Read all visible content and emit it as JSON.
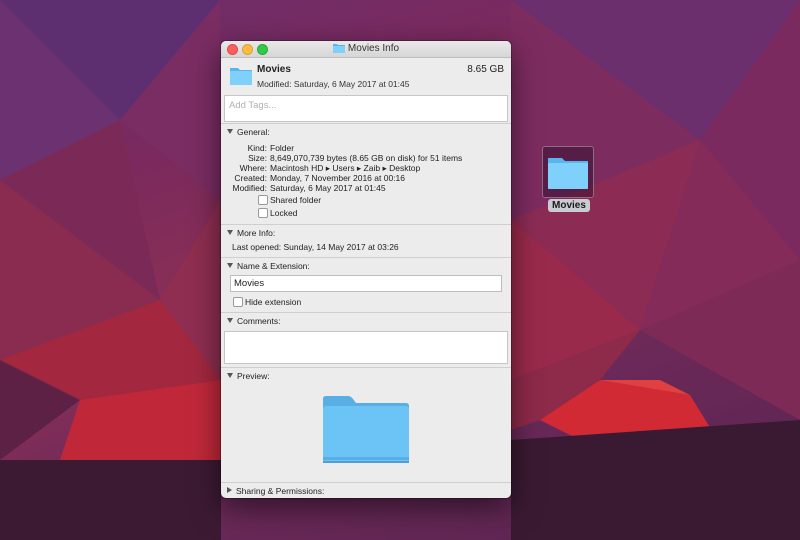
{
  "desktop": {
    "folder_label": "Movies"
  },
  "window": {
    "title": "Movies Info",
    "name": "Movies",
    "size": "8.65 GB",
    "modified_line": "Modified: Saturday, 6 May 2017 at 01:45",
    "tags_placeholder": "Add Tags...",
    "general": {
      "header": "General:",
      "rows": [
        {
          "label": "Kind:",
          "value": "Folder"
        },
        {
          "label": "Size:",
          "value": "8,649,070,739 bytes (8.65 GB on disk) for 51 items"
        },
        {
          "label": "Where:",
          "value": "Macintosh HD ▸ Users ▸ Zaib ▸ Desktop"
        },
        {
          "label": "Created:",
          "value": "Monday, 7 November 2016 at 00:16"
        },
        {
          "label": "Modified:",
          "value": "Saturday, 6 May 2017 at 01:45"
        }
      ],
      "shared_folder": "Shared folder",
      "locked": "Locked"
    },
    "more_info": {
      "header": "More Info:",
      "last_opened": "Last opened: Sunday, 14 May 2017 at 03:26"
    },
    "name_ext": {
      "header": "Name & Extension:",
      "value": "Movies",
      "hide_extension": "Hide extension"
    },
    "comments": {
      "header": "Comments:"
    },
    "preview": {
      "header": "Preview:"
    },
    "sharing": {
      "header": "Sharing & Permissions:"
    }
  },
  "colors": {
    "folder_blue": "#6cc3f5",
    "wallpaper": "#7a2a5e"
  }
}
